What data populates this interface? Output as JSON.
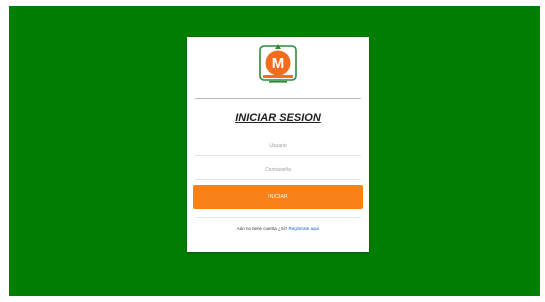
{
  "login": {
    "title": "INICIAR SESION",
    "user_placeholder": "Usuario",
    "password_placeholder": "Contraseña",
    "submit_label": "INICIAR",
    "footer_text": "Aún no tiene cuenta ¿Si? ",
    "footer_link": "Regístrate aquí"
  },
  "colors": {
    "background": "#017f02",
    "button": "#f7821a",
    "link": "#1a5fd0"
  },
  "icons": {
    "logo": "m-letter-tomato-logo"
  }
}
